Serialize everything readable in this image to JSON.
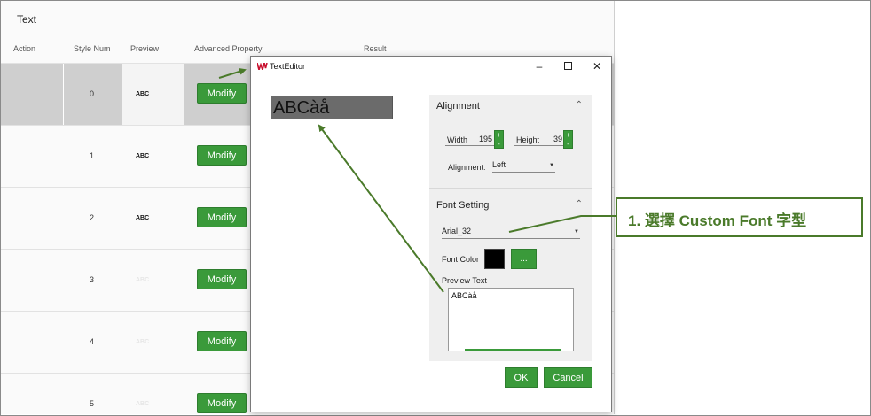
{
  "app": {
    "title": "Text",
    "columns": [
      "Action",
      "Style Num",
      "Preview",
      "Advanced Property",
      "Result"
    ],
    "rows": [
      {
        "style_num": "0",
        "preview": "ABC",
        "button": "Modify"
      },
      {
        "style_num": "1",
        "preview": "ABC",
        "button": "Modify"
      },
      {
        "style_num": "2",
        "preview": "ABC",
        "button": "Modify"
      },
      {
        "style_num": "3",
        "preview": "ABC",
        "button": "Modify"
      },
      {
        "style_num": "4",
        "preview": "ABC",
        "button": "Modify"
      },
      {
        "style_num": "5",
        "preview": "ABC",
        "button": "Modify"
      }
    ]
  },
  "dialog": {
    "title": "TextEditor",
    "preview_text": "ABCàå",
    "alignment_section": {
      "title": "Alignment",
      "width_label": "Width",
      "width_value": "195",
      "height_label": "Height",
      "height_value": "39",
      "alignment_label": "Alignment:",
      "alignment_value": "Left"
    },
    "font_section": {
      "title": "Font Setting",
      "font_value": "Arial_32",
      "font_color_label": "Font Color",
      "font_color": "#000000",
      "pick_label": "...",
      "preview_label": "Preview Text",
      "preview_value": "ABCàå"
    },
    "ok_label": "OK",
    "cancel_label": "Cancel"
  },
  "callout": {
    "text": "1.  選擇 Custom Font  字型"
  },
  "colors": {
    "accent_green": "#3a9a3a",
    "annotation_green": "#4a7a2a"
  }
}
